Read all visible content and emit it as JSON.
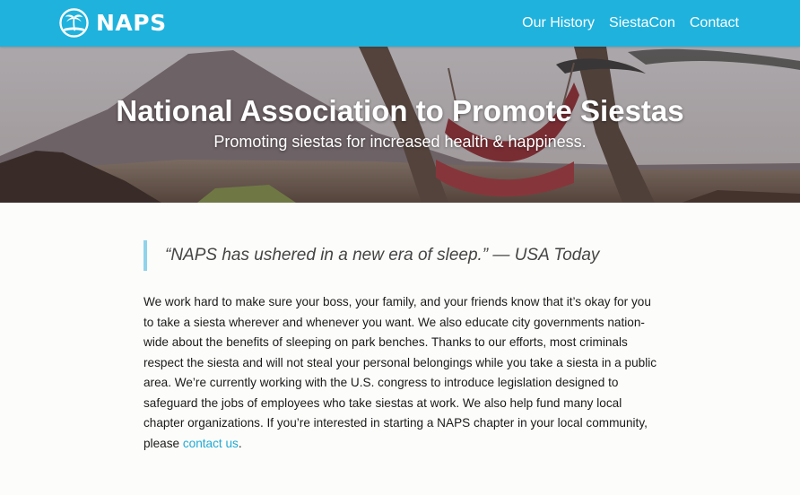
{
  "brand": {
    "name": "NAPS"
  },
  "nav": {
    "links": [
      "Our History",
      "SiestaCon",
      "Contact"
    ]
  },
  "hero": {
    "title": "National Association to Promote Siestas",
    "subtitle": "Promoting siestas for increased health & happiness."
  },
  "quote": {
    "text": "“NAPS has ushered in a new era of sleep.” — USA Today"
  },
  "body": {
    "paragraph": "We work hard to make sure your boss, your family, and your friends know that it’s okay for you to take a siesta wherever and whenever you want. We also educate city governments nation-wide about the benefits of sleeping on park benches. Thanks to our efforts, most criminals respect the siesta and will not steal your personal belongings while you take a siesta in a public area. We’re currently working with the U.S. congress to introduce legislation designed to safeguard the jobs of employees who take siestas at work. We also help fund many local chapter organizations. If you’re interested in starting a NAPS chapter in your local community, please",
    "link_text": "contact us",
    "trailing": "."
  },
  "colors": {
    "navbar": "#1fb2dd",
    "link": "#1fa9d6",
    "quote_border": "#8fd3ec"
  }
}
